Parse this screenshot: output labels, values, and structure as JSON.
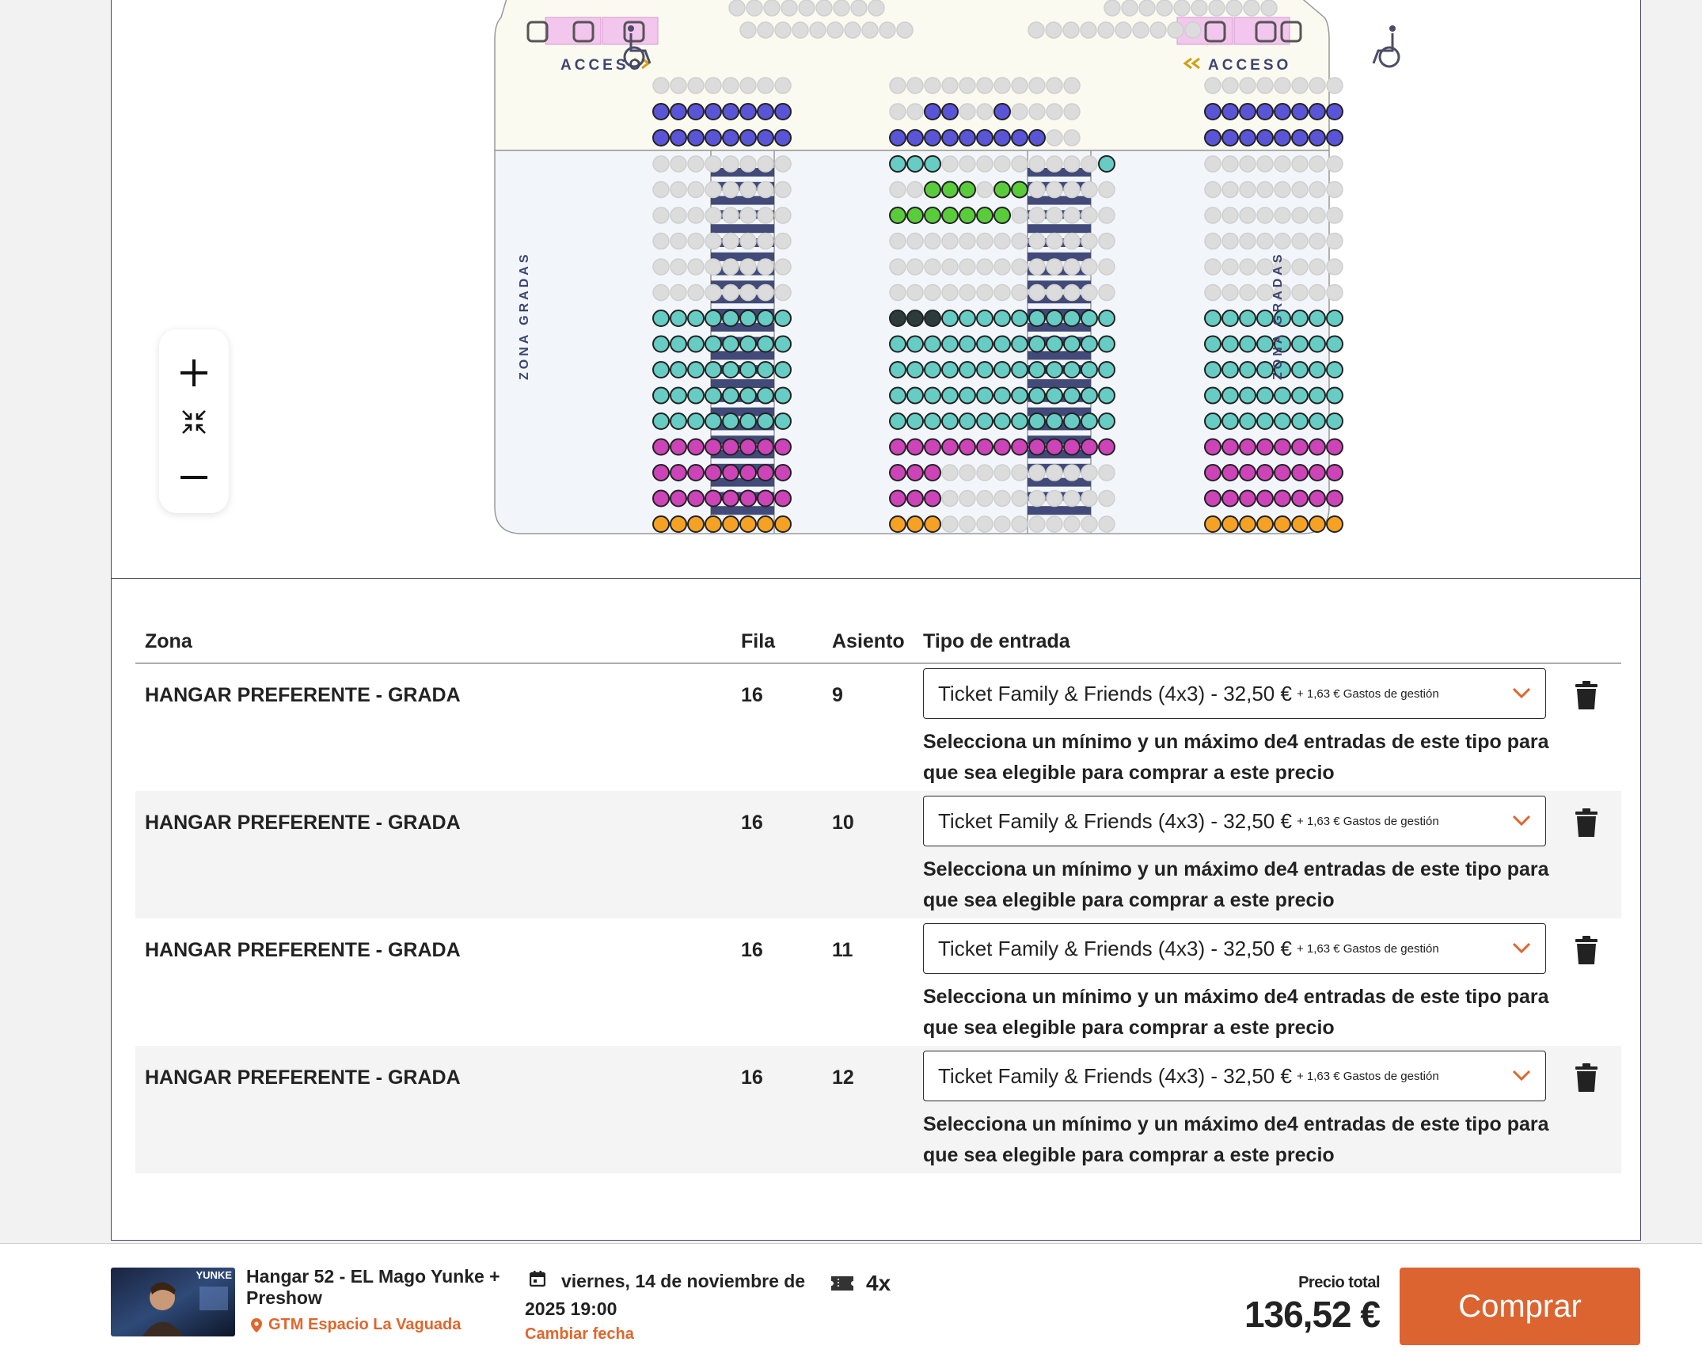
{
  "seatmap": {
    "access_left": "ACCESO",
    "access_right": "ACCESO",
    "side_zone_left": "ZONA GRADAS",
    "side_zone_right": "ZONA GRADAS"
  },
  "zoom": {
    "zoom_in_icon": "plus-icon",
    "reset_icon": "collapse-arrows-icon",
    "zoom_out_icon": "minus-icon"
  },
  "table": {
    "headers": {
      "zona": "Zona",
      "fila": "Fila",
      "asiento": "Asiento",
      "tipo": "Tipo de entrada"
    },
    "rows": [
      {
        "zona": "HANGAR PREFERENTE - GRADA",
        "fila": "16",
        "asiento": "9",
        "ticket": "Ticket Family & Friends (4x3) - 32,50 €",
        "fee": "+ 1,63 € Gastos de gestión",
        "note": "Selecciona un mínimo y un máximo de4 entradas de este tipo para que sea elegible para comprar a este precio"
      },
      {
        "zona": "HANGAR PREFERENTE - GRADA",
        "fila": "16",
        "asiento": "10",
        "ticket": "Ticket Family & Friends (4x3) - 32,50 €",
        "fee": "+ 1,63 € Gastos de gestión",
        "note": "Selecciona un mínimo y un máximo de4 entradas de este tipo para que sea elegible para comprar a este precio"
      },
      {
        "zona": "HANGAR PREFERENTE - GRADA",
        "fila": "16",
        "asiento": "11",
        "ticket": "Ticket Family & Friends (4x3) - 32,50 €",
        "fee": "+ 1,63 € Gastos de gestión",
        "note": "Selecciona un mínimo y un máximo de4 entradas de este tipo para que sea elegible para comprar a este precio"
      },
      {
        "zona": "HANGAR PREFERENTE - GRADA",
        "fila": "16",
        "asiento": "12",
        "ticket": "Ticket Family & Friends (4x3) - 32,50 €",
        "fee": "+ 1,63 € Gastos de gestión",
        "note": "Selecciona un mínimo y un máximo de4 entradas de este tipo para que sea elegible para comprar a este precio"
      }
    ]
  },
  "footer": {
    "event_title": "Hangar 52 - EL Mago Yunke + Preshow",
    "venue": "GTM Espacio La Vaguada",
    "date": "viernes, 14 de noviembre de 2025 19:00",
    "change_date": "Cambiar fecha",
    "quantity": "4x",
    "total_label": "Precio total",
    "total_value": "136,52 €",
    "buy_label": "Comprar",
    "thumb_text": "YUNKE"
  },
  "colors": {
    "accent": "#dc6430",
    "seat_unavailable": "#dcdcdc",
    "seat_blue": "#5a55d6",
    "seat_teal": "#66ccc4",
    "seat_green": "#5acc3c",
    "seat_magenta": "#cc44b8",
    "seat_orange": "#f5a224",
    "seat_selected": "#2c3c3c",
    "stairs": "#414a78"
  }
}
